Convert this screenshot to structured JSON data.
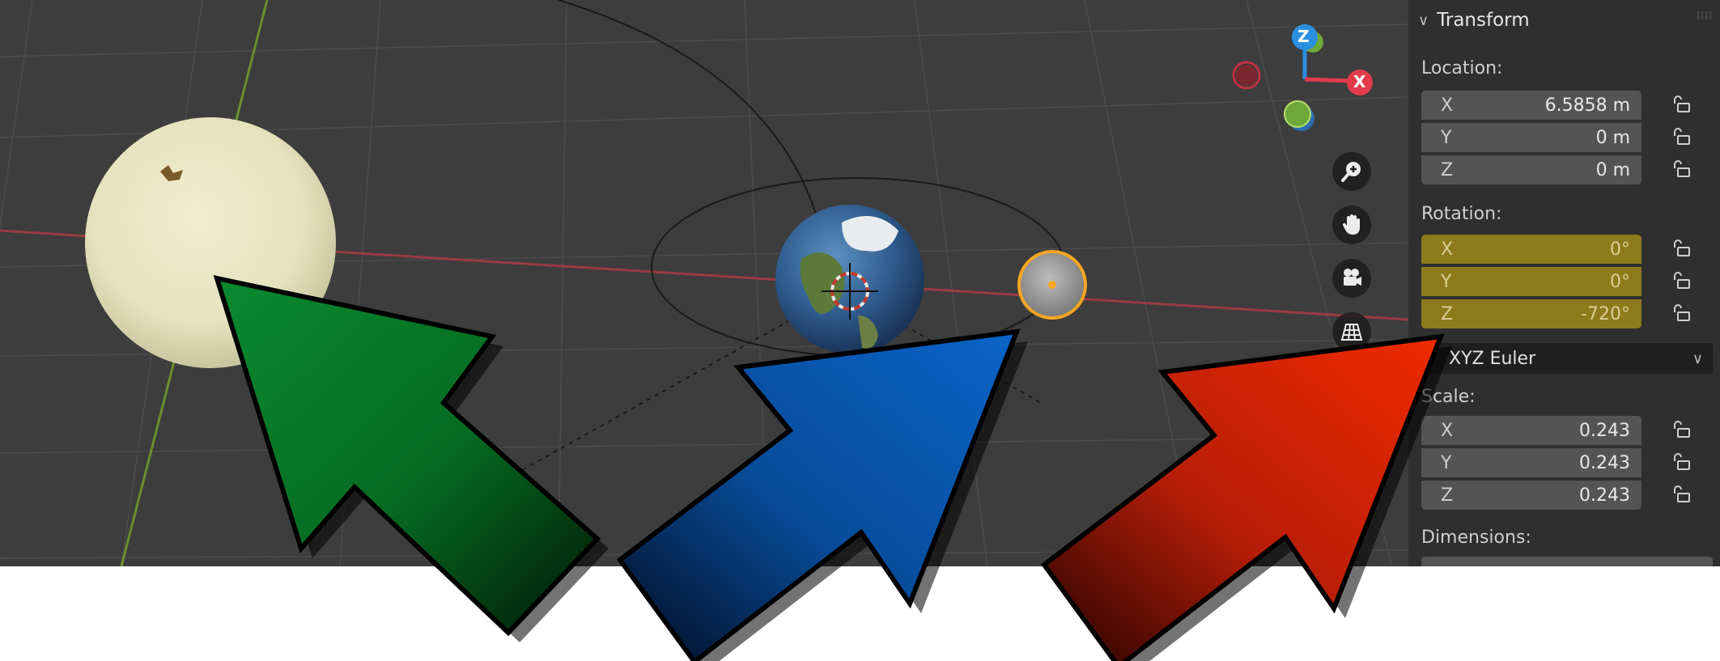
{
  "panel": {
    "header": "Transform",
    "location": {
      "label": "Location:",
      "rows": [
        {
          "axis": "X",
          "value": "6.5858 m"
        },
        {
          "axis": "Y",
          "value": "0 m"
        },
        {
          "axis": "Z",
          "value": "0 m"
        }
      ]
    },
    "rotation": {
      "label": "Rotation:",
      "rows": [
        {
          "axis": "X",
          "value": "0°"
        },
        {
          "axis": "Y",
          "value": "0°"
        },
        {
          "axis": "Z",
          "value": "-720°"
        }
      ]
    },
    "rotation_mode": "XYZ Euler",
    "scale": {
      "label": "Scale:",
      "rows": [
        {
          "axis": "X",
          "value": "0.243"
        },
        {
          "axis": "Y",
          "value": "0.243"
        },
        {
          "axis": "Z",
          "value": "0.243"
        }
      ]
    },
    "dimensions_label": "Dimensions:"
  },
  "gizmo": {
    "z": "Z",
    "x": "X"
  },
  "colors": {
    "viewport_bg": "#3d3d3d",
    "panel_bg": "#2f2f2f",
    "keyframed_field": "#8d7a1c",
    "arrow_green": "#0a8a30",
    "arrow_blue": "#0a64c8",
    "arrow_red": "#f02a00",
    "selection_orange": "#f5a623"
  },
  "icons": [
    "zoom-icon",
    "hand-pan-icon",
    "camera-icon",
    "grid-perspective-icon",
    "lock-icon",
    "chevron-down-icon"
  ]
}
